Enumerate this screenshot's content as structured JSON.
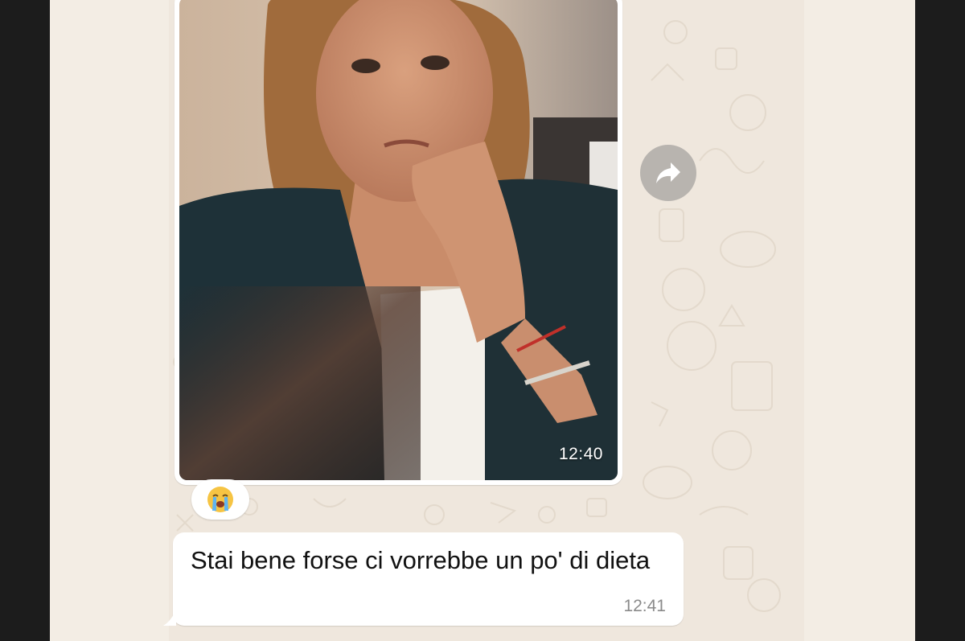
{
  "image_message": {
    "photo_description_icon": "photo-woman-in-blazer",
    "time": "12:40"
  },
  "forward_button": {
    "icon": "forward-arrow-icon"
  },
  "reaction": {
    "emoji": "loudly-crying-face-icon"
  },
  "text_message": {
    "text": "Stai bene forse ci vorrebbe un po' di dieta",
    "time": "12:41"
  },
  "colors": {
    "chat_background": "#efe7dd",
    "bubble": "#ffffff",
    "page_background": "#1c1c1c"
  }
}
